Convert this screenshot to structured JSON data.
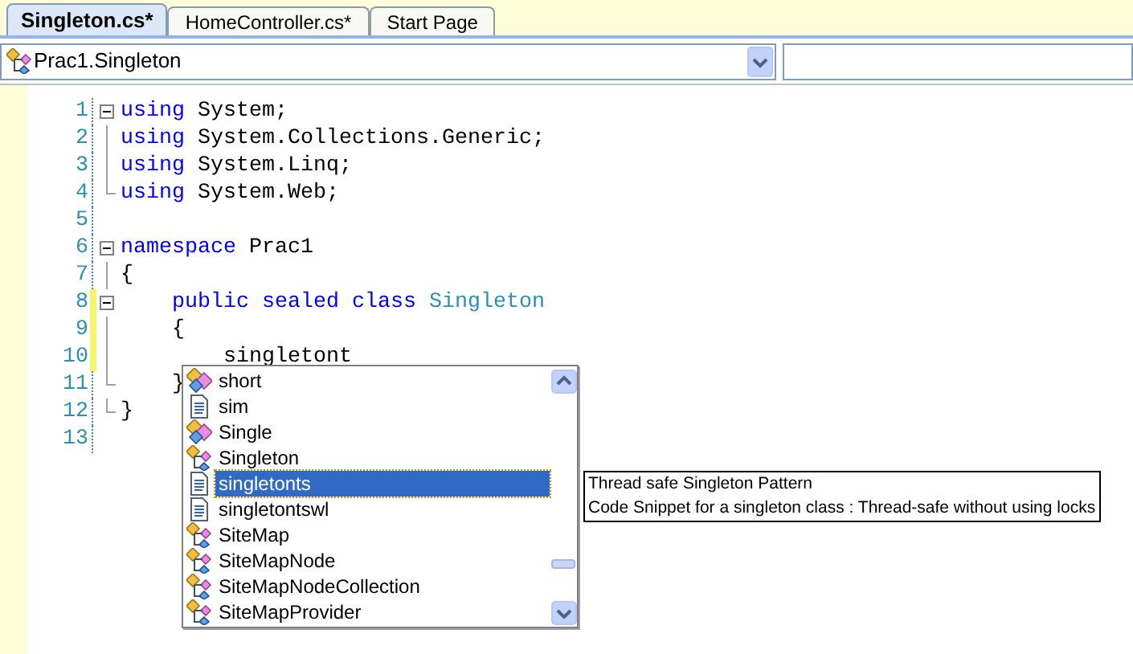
{
  "tabs": [
    {
      "label": "Singleton.cs*",
      "selected": true
    },
    {
      "label": "HomeController.cs*",
      "selected": false
    },
    {
      "label": "Start Page",
      "selected": false
    }
  ],
  "navigation": {
    "type_dropdown": "Prac1.Singleton"
  },
  "code_lines": [
    {
      "number": "1",
      "kind": "open",
      "modified": false,
      "tokens": [
        {
          "text": "using",
          "kind": "keyword"
        },
        {
          "text": " System;",
          "kind": "plain"
        }
      ]
    },
    {
      "number": "2",
      "kind": "inside",
      "modified": false,
      "tokens": [
        {
          "text": "using",
          "kind": "keyword"
        },
        {
          "text": " System.Collections.Generic;",
          "kind": "plain"
        }
      ]
    },
    {
      "number": "3",
      "kind": "inside",
      "modified": false,
      "tokens": [
        {
          "text": "using",
          "kind": "keyword"
        },
        {
          "text": " System.Linq;",
          "kind": "plain"
        }
      ]
    },
    {
      "number": "4",
      "kind": "close",
      "modified": false,
      "tokens": [
        {
          "text": "using",
          "kind": "keyword"
        },
        {
          "text": " System.Web;",
          "kind": "plain"
        }
      ]
    },
    {
      "number": "5",
      "kind": "plain",
      "modified": false
    },
    {
      "number": "6",
      "kind": "open",
      "modified": false,
      "tokens": [
        {
          "text": "namespace",
          "kind": "keyword"
        },
        {
          "text": " Prac1",
          "kind": "plain"
        }
      ]
    },
    {
      "number": "7",
      "kind": "inside",
      "modified": false,
      "tokens": [
        {
          "text": "{",
          "kind": "plain"
        }
      ]
    },
    {
      "number": "8",
      "kind": "open",
      "modified": true,
      "tokens": [
        {
          "text": "    public sealed class",
          "kind": "keyword"
        },
        {
          "text": " Singleton",
          "kind": "type"
        }
      ]
    },
    {
      "number": "9",
      "kind": "inside",
      "modified": true,
      "tokens": [
        {
          "text": "    {",
          "kind": "plain"
        }
      ]
    },
    {
      "number": "10",
      "kind": "inside",
      "modified": true,
      "tokens": [
        {
          "text": "        singletont",
          "kind": "plain"
        }
      ]
    },
    {
      "number": "11",
      "kind": "close",
      "modified": false,
      "tokens": [
        {
          "text": "    }",
          "kind": "plain"
        }
      ]
    },
    {
      "number": "12",
      "kind": "close",
      "modified": false,
      "tokens": [
        {
          "text": "}",
          "kind": "plain"
        }
      ]
    },
    {
      "number": "13",
      "kind": "plain",
      "modified": false
    }
  ],
  "completion_list": {
    "items": [
      {
        "label": "short",
        "kind": "struct",
        "selected": false
      },
      {
        "label": "sim",
        "kind": "snippet",
        "selected": false
      },
      {
        "label": "Single",
        "kind": "struct",
        "selected": false
      },
      {
        "label": "Singleton",
        "kind": "class",
        "selected": false
      },
      {
        "label": "singletonts",
        "kind": "snippet",
        "selected": true
      },
      {
        "label": "singletontswl",
        "kind": "snippet",
        "selected": false
      },
      {
        "label": "SiteMap",
        "kind": "class",
        "selected": false
      },
      {
        "label": "SiteMapNode",
        "kind": "class",
        "selected": false
      },
      {
        "label": "SiteMapNodeCollection",
        "kind": "class",
        "selected": false
      },
      {
        "label": "SiteMapProvider",
        "kind": "class",
        "selected": false
      }
    ]
  },
  "tooltip": {
    "title": "Thread safe Singleton Pattern",
    "description": "Code Snippet for a singleton class : Thread-safe without using locks"
  }
}
